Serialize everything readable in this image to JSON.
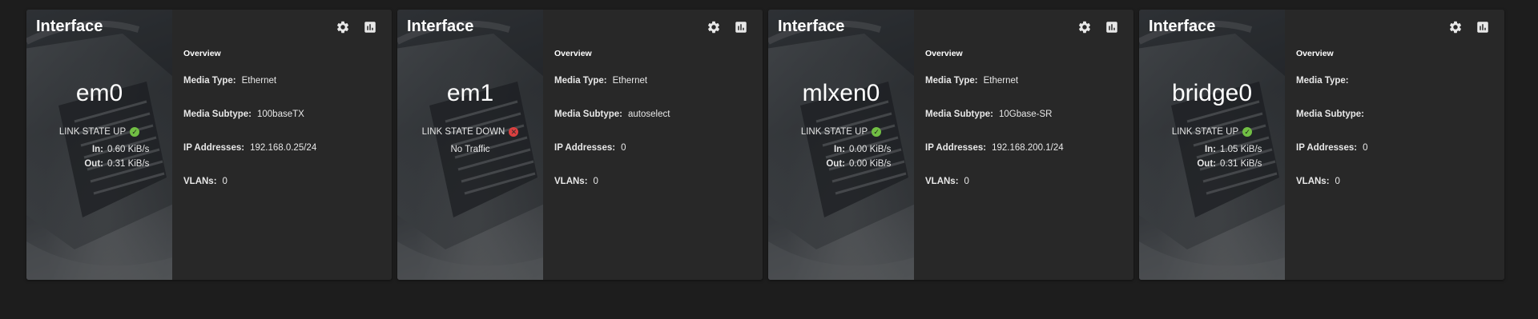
{
  "cards": [
    {
      "title": "Interface",
      "name": "em0",
      "link_state": "LINK STATE UP",
      "link_up": true,
      "in_label": "In:",
      "in_value": "0.60 KiB/s",
      "out_label": "Out:",
      "out_value": "0.31 KiB/s",
      "no_traffic": "",
      "icons": {
        "settings": "gear-icon",
        "stats": "bar-chart-icon"
      },
      "section": "Overview",
      "props": [
        {
          "key": "Media Type:",
          "value": "Ethernet"
        },
        {
          "key": "Media Subtype:",
          "value": "100baseTX"
        },
        {
          "key": "IP Addresses:",
          "value": "192.168.0.25/24"
        },
        {
          "key": "VLANs:",
          "value": "0"
        }
      ]
    },
    {
      "title": "Interface",
      "name": "em1",
      "link_state": "LINK STATE DOWN",
      "link_up": false,
      "in_label": "",
      "in_value": "",
      "out_label": "",
      "out_value": "",
      "no_traffic": "No Traffic",
      "icons": {
        "settings": "gear-icon",
        "stats": "bar-chart-icon"
      },
      "section": "Overview",
      "props": [
        {
          "key": "Media Type:",
          "value": "Ethernet"
        },
        {
          "key": "Media Subtype:",
          "value": "autoselect"
        },
        {
          "key": "IP Addresses:",
          "value": "0"
        },
        {
          "key": "VLANs:",
          "value": "0"
        }
      ]
    },
    {
      "title": "Interface",
      "name": "mlxen0",
      "link_state": "LINK STATE UP",
      "link_up": true,
      "in_label": "In:",
      "in_value": "0.00 KiB/s",
      "out_label": "Out:",
      "out_value": "0.00 KiB/s",
      "no_traffic": "",
      "icons": {
        "settings": "gear-icon",
        "stats": "bar-chart-icon"
      },
      "section": "Overview",
      "props": [
        {
          "key": "Media Type:",
          "value": "Ethernet"
        },
        {
          "key": "Media Subtype:",
          "value": "10Gbase-SR"
        },
        {
          "key": "IP Addresses:",
          "value": "192.168.200.1/24"
        },
        {
          "key": "VLANs:",
          "value": "0"
        }
      ]
    },
    {
      "title": "Interface",
      "name": "bridge0",
      "link_state": "LINK STATE UP",
      "link_up": true,
      "in_label": "In:",
      "in_value": "1.05 KiB/s",
      "out_label": "Out:",
      "out_value": "0.31 KiB/s",
      "no_traffic": "",
      "icons": {
        "settings": "gear-icon",
        "stats": "bar-chart-icon"
      },
      "section": "Overview",
      "props": [
        {
          "key": "Media Type:",
          "value": ""
        },
        {
          "key": "Media Subtype:",
          "value": ""
        },
        {
          "key": "IP Addresses:",
          "value": "0"
        },
        {
          "key": "VLANs:",
          "value": "0"
        }
      ]
    }
  ],
  "colors": {
    "page_bg": "#1d1d1d",
    "card_bg": "#282828",
    "status_up": "#71bf44",
    "status_down": "#d94040"
  }
}
